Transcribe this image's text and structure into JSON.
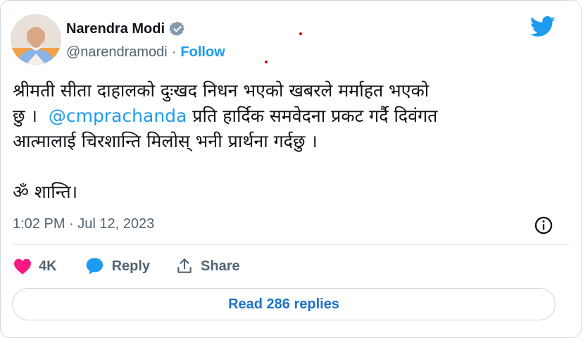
{
  "author": {
    "name": "Narendra Modi",
    "handle": "@narendramodi",
    "separator": "·",
    "follow_label": "Follow"
  },
  "tweet": {
    "line1": "श्रीमती सीता दाहालको दुःखद निधन भएको खबरले मर्माहत भएको",
    "line2_pre": "छु ।  ",
    "mention": "@cmprachanda",
    "line2_post": " प्रति हार्दिक समवेदना प्रकट गर्दै दिवंगत",
    "line3": "आत्मालाई चिरशान्ति मिलोस् भनी प्रार्थना गर्दछु ।",
    "line4": "ॐ शान्ति।"
  },
  "timestamp": "1:02 PM · Jul 12, 2023",
  "actions": {
    "likes": "4K",
    "reply_label": "Reply",
    "share_label": "Share"
  },
  "read_replies_label": "Read 286 replies",
  "colors": {
    "accent": "#1d9bf0",
    "heart": "#f91880",
    "text_secondary": "#536471"
  },
  "icons": [
    "verified-icon",
    "twitter-bird-icon",
    "info-icon",
    "heart-icon",
    "reply-bubble-icon",
    "share-icon"
  ]
}
